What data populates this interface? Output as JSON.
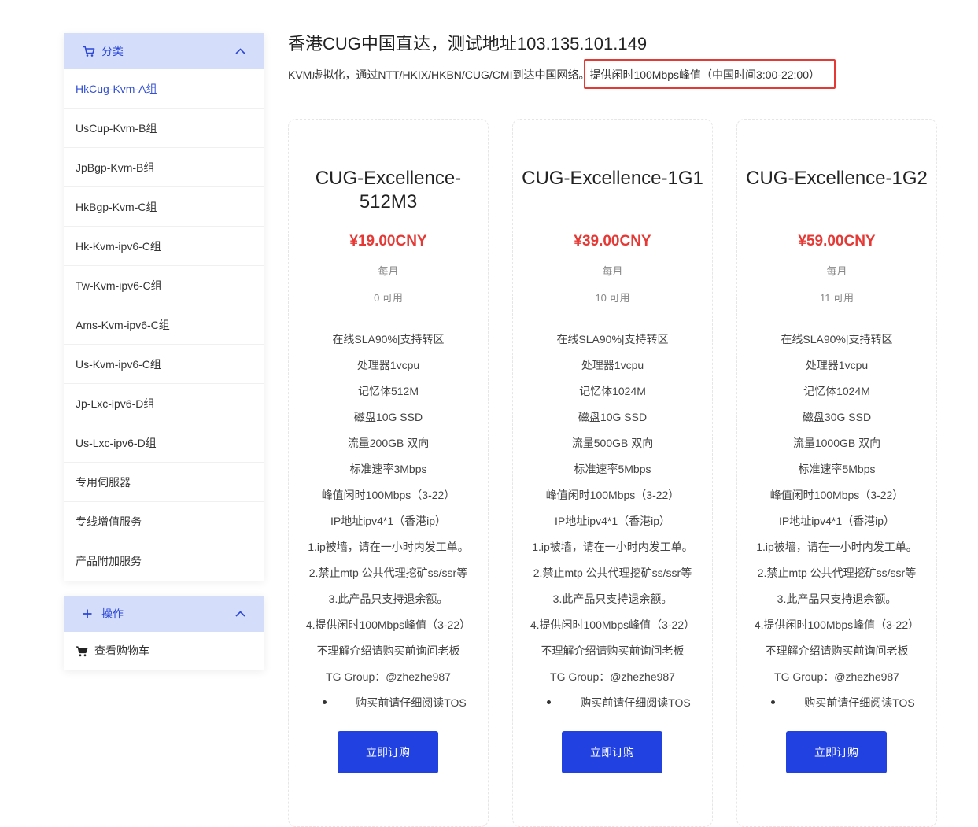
{
  "sidebar": {
    "categories_title": "分类",
    "categories": [
      {
        "label": "HkCug-Kvm-A组",
        "active": true
      },
      {
        "label": "UsCup-Kvm-B组"
      },
      {
        "label": "JpBgp-Kvm-B组"
      },
      {
        "label": "HkBgp-Kvm-C组"
      },
      {
        "label": "Hk-Kvm-ipv6-C组"
      },
      {
        "label": "Tw-Kvm-ipv6-C组"
      },
      {
        "label": "Ams-Kvm-ipv6-C组"
      },
      {
        "label": "Us-Kvm-ipv6-C组"
      },
      {
        "label": "Jp-Lxc-ipv6-D组"
      },
      {
        "label": "Us-Lxc-ipv6-D组"
      },
      {
        "label": "专用伺服器"
      },
      {
        "label": "专线增值服务"
      },
      {
        "label": "产品附加服务"
      }
    ],
    "actions_title": "操作",
    "actions": [
      {
        "label": "查看购物车"
      }
    ]
  },
  "header": {
    "title": "香港CUG中国直达，测试地址103.135.101.149",
    "description": "KVM虚拟化，通过NTT/HKIX/HKBN/CUG/CMI到达中国网络。提供闲时100Mbps峰值（中国时间3:00-22:00）"
  },
  "products": [
    {
      "name": "CUG-Excellence-512M3",
      "price": "¥19.00CNY",
      "cycle": "每月",
      "available": "0 可用",
      "features": [
        "在线SLA90%|支持转区",
        "处理器1vcpu",
        "记忆体512M",
        "磁盘10G SSD",
        "流量200GB 双向",
        "标准速率3Mbps",
        "峰值闲时100Mbps（3-22）",
        "IP地址ipv4*1（香港ip）",
        "1.ip被墙，请在一小时内发工单。",
        "2.禁止mtp 公共代理挖矿ss/ssr等",
        "3.此产品只支持退余额。",
        "4.提供闲时100Mbps峰值（3-22）",
        "不理解介绍请购买前询问老板",
        "TG Group：@zhezhe987"
      ],
      "tos": "购买前请仔细阅读TOS",
      "button": "立即订购"
    },
    {
      "name": "CUG-Excellence-1G1",
      "price": "¥39.00CNY",
      "cycle": "每月",
      "available": "10 可用",
      "features": [
        "在线SLA90%|支持转区",
        "处理器1vcpu",
        "记忆体1024M",
        "磁盘10G SSD",
        "流量500GB 双向",
        "标准速率5Mbps",
        "峰值闲时100Mbps（3-22）",
        "IP地址ipv4*1（香港ip）",
        "1.ip被墙，请在一小时内发工单。",
        "2.禁止mtp 公共代理挖矿ss/ssr等",
        "3.此产品只支持退余额。",
        "4.提供闲时100Mbps峰值（3-22）",
        "不理解介绍请购买前询问老板",
        "TG Group：@zhezhe987"
      ],
      "tos": "购买前请仔细阅读TOS",
      "button": "立即订购"
    },
    {
      "name": "CUG-Excellence-1G2",
      "price": "¥59.00CNY",
      "cycle": "每月",
      "available": "11 可用",
      "features": [
        "在线SLA90%|支持转区",
        "处理器1vcpu",
        "记忆体1024M",
        "磁盘30G SSD",
        "流量1000GB 双向",
        "标准速率5Mbps",
        "峰值闲时100Mbps（3-22）",
        "IP地址ipv4*1（香港ip）",
        "1.ip被墙，请在一小时内发工单。",
        "2.禁止mtp 公共代理挖矿ss/ssr等",
        "3.此产品只支持退余额。",
        "4.提供闲时100Mbps峰值（3-22）",
        "不理解介绍请购买前询问老板",
        "TG Group：@zhezhe987"
      ],
      "tos": "购买前请仔细阅读TOS",
      "button": "立即订购"
    }
  ],
  "colors": {
    "accent": "#2141e0",
    "panel_header_bg": "#d4defb",
    "price": "#e53935",
    "highlight_border": "#e53935"
  },
  "icons": {
    "categories": "cart-icon",
    "actions": "plus-icon",
    "collapse": "chevron-up-icon",
    "view_cart": "cart-icon"
  }
}
